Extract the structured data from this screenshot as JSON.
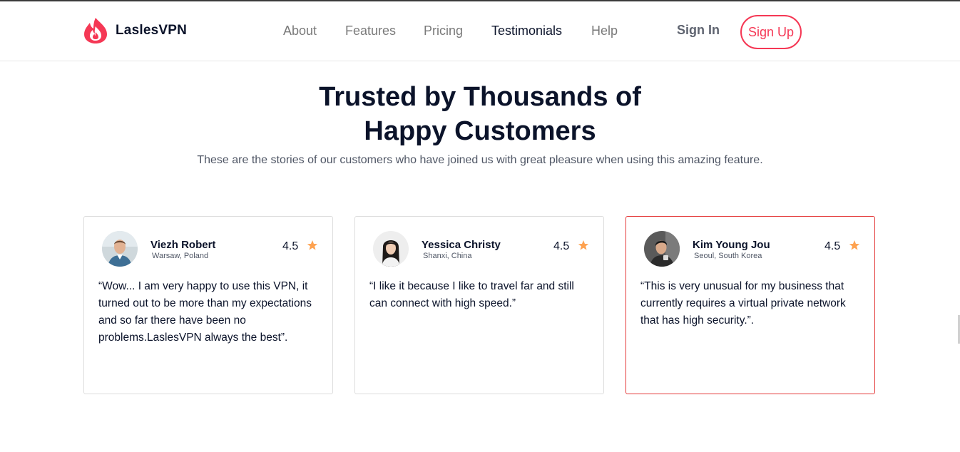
{
  "brand": {
    "name": "LaslesVPN",
    "accent": "#f53855"
  },
  "nav": {
    "items": [
      {
        "label": "About"
      },
      {
        "label": "Features"
      },
      {
        "label": "Pricing"
      },
      {
        "label": "Testimonials",
        "active": true
      },
      {
        "label": "Help"
      }
    ]
  },
  "auth": {
    "signin_label": "Sign In",
    "signup_label": "Sign Up"
  },
  "hero": {
    "title_line1": "Trusted by Thousands of",
    "title_line2": "Happy Customers",
    "subtitle": "These are the stories of our customers who have joined us with great pleasure when using this amazing feature."
  },
  "testimonials": [
    {
      "name": "Viezh Robert",
      "location": "Warsaw, Poland",
      "rating": "4.5",
      "quote": "“Wow... I am very happy to use this VPN, it turned out to be more than my expectations and so far there have been no problems.LaslesVPN always the best”.",
      "icon": "star-icon"
    },
    {
      "name": "Yessica Christy",
      "location": "Shanxi, China",
      "rating": "4.5",
      "quote": "“I like it because I like to travel far and still can connect with high speed.”",
      "icon": "star-icon"
    },
    {
      "name": "Kim Young Jou",
      "location": "Seoul, South Korea",
      "rating": "4.5",
      "quote": "“This is very unusual for my business that currently requires a virtual private network that has high security.”.",
      "icon": "star-icon",
      "highlighted": true
    }
  ],
  "colors": {
    "star": "#fea250",
    "text_dark": "#0b132a",
    "text_muted": "#4f5665"
  }
}
